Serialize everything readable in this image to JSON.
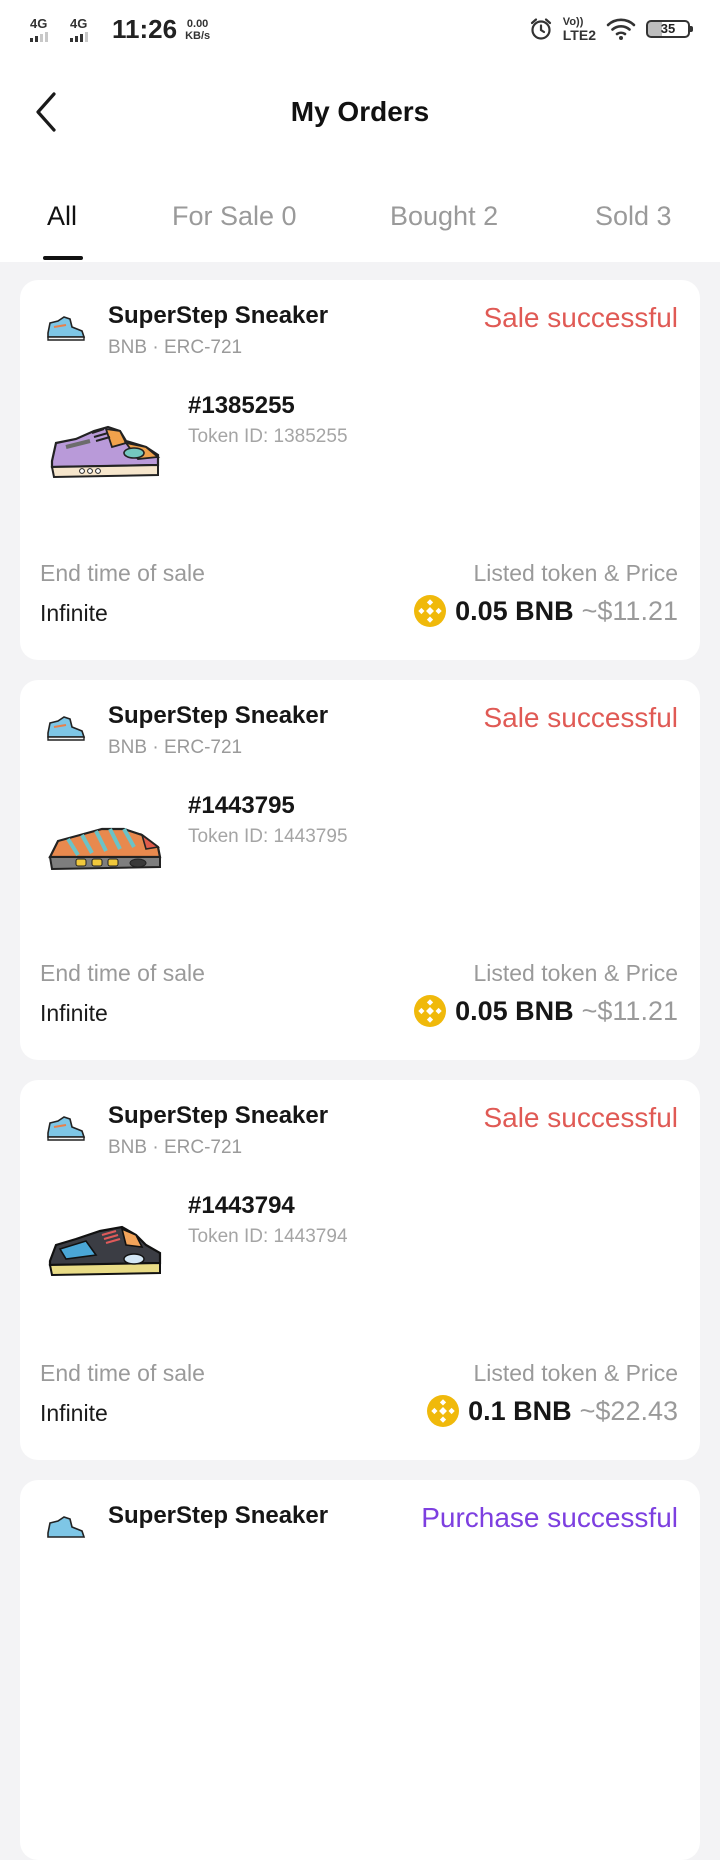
{
  "status_bar": {
    "net1": "4G",
    "net2": "4G",
    "time": "11:26",
    "speed_value": "0.00",
    "speed_unit": "KB/s",
    "volte": "Vo))",
    "lte": "LTE2",
    "battery": "35"
  },
  "header": {
    "title": "My Orders"
  },
  "tabs": [
    {
      "label": "All",
      "active": true
    },
    {
      "label": "For Sale 0",
      "active": false
    },
    {
      "label": "Bought 2",
      "active": false
    },
    {
      "label": "Sold 3",
      "active": false
    }
  ],
  "orders": [
    {
      "product": "SuperStep Sneaker",
      "chain": "BNB · ERC-721",
      "status": "Sale successful",
      "token_no": "#1385255",
      "token_id": "Token ID: 1385255",
      "end_time_label": "End time of sale",
      "end_time_value": "Infinite",
      "price_label": "Listed token & Price",
      "price": "0.05 BNB",
      "usd": "~$11.21"
    },
    {
      "product": "SuperStep Sneaker",
      "chain": "BNB · ERC-721",
      "status": "Sale successful",
      "token_no": "#1443795",
      "token_id": "Token ID: 1443795",
      "end_time_label": "End time of sale",
      "end_time_value": "Infinite",
      "price_label": "Listed token & Price",
      "price": "0.05 BNB",
      "usd": "~$11.21"
    },
    {
      "product": "SuperStep Sneaker",
      "chain": "BNB · ERC-721",
      "status": "Sale successful",
      "token_no": "#1443794",
      "token_id": "Token ID: 1443794",
      "end_time_label": "End time of sale",
      "end_time_value": "Infinite",
      "price_label": "Listed token & Price",
      "price": "0.1 BNB",
      "usd": "~$22.43"
    },
    {
      "product": "SuperStep Sneaker",
      "status": "Purchase successful"
    }
  ],
  "colors": {
    "sale_status": "#e05a55",
    "purchase_status": "#7d3fe0",
    "bnb": "#f0b90b"
  },
  "icons": {
    "back": "chevron-left-icon",
    "token": "bnb-coin-icon",
    "alarm": "alarm-clock-icon",
    "wifi": "wifi-icon",
    "battery": "battery-icon"
  }
}
